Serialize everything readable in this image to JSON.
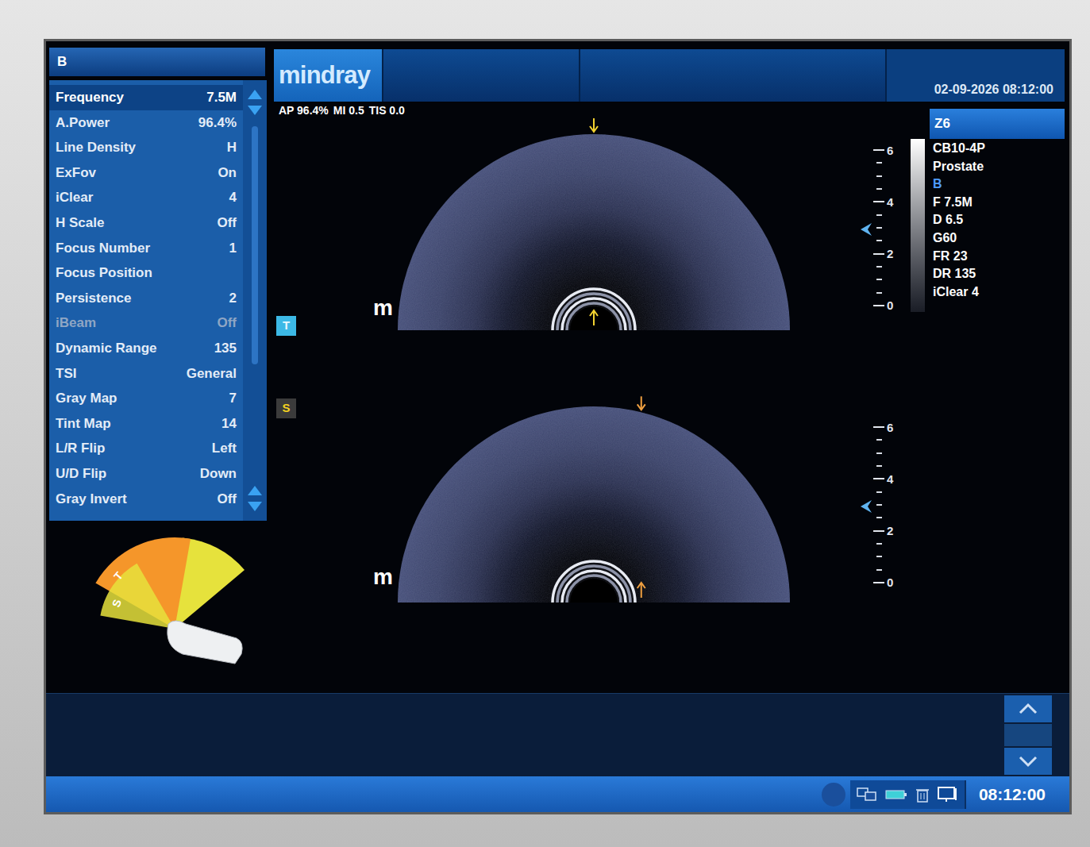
{
  "mode_panel": {
    "title": "B",
    "params": [
      {
        "label": "Frequency",
        "value": "7.5M",
        "selected": true,
        "disabled": false
      },
      {
        "label": "A.Power",
        "value": "96.4%",
        "selected": false,
        "disabled": false
      },
      {
        "label": "Line Density",
        "value": "H",
        "selected": false,
        "disabled": false
      },
      {
        "label": "ExFov",
        "value": "On",
        "selected": false,
        "disabled": false
      },
      {
        "label": "iClear",
        "value": "4",
        "selected": false,
        "disabled": false
      },
      {
        "label": "H Scale",
        "value": "Off",
        "selected": false,
        "disabled": false
      },
      {
        "label": "Focus Number",
        "value": "1",
        "selected": false,
        "disabled": false
      },
      {
        "label": "Focus Position",
        "selected": false,
        "disabled": false
      },
      {
        "label": "Persistence",
        "value": "2",
        "selected": false,
        "disabled": false
      },
      {
        "label": "iBeam",
        "value": "Off",
        "selected": false,
        "disabled": true
      },
      {
        "label": "Dynamic Range",
        "value": "135",
        "selected": false,
        "disabled": false
      },
      {
        "label": "TSI",
        "value": "General",
        "selected": false,
        "disabled": false
      },
      {
        "label": "Gray Map",
        "value": "7",
        "selected": false,
        "disabled": false
      },
      {
        "label": "Tint Map",
        "value": "14",
        "selected": false,
        "disabled": false
      },
      {
        "label": "L/R Flip",
        "value": "Left",
        "selected": false,
        "disabled": false
      },
      {
        "label": "U/D Flip",
        "value": "Down",
        "selected": false,
        "disabled": false
      },
      {
        "label": "Gray Invert",
        "value": "Off",
        "selected": false,
        "disabled": false
      }
    ]
  },
  "header": {
    "logo": "mindray",
    "datetime": "02-09-2026 08:12:00"
  },
  "acoustic": [
    "AP 96.4%",
    "MI 0.5",
    "TIS 0.0"
  ],
  "images": [
    {
      "label": "T",
      "selected": true,
      "logo": "m",
      "scale": [
        "6",
        "4",
        "2",
        "0"
      ],
      "focus": 0.49,
      "line_angle": 0
    },
    {
      "label": "S",
      "selected": false,
      "logo": "m",
      "scale": [
        "6",
        "4",
        "2",
        "0"
      ],
      "focus": 0.49,
      "line_angle": 14
    }
  ],
  "info": {
    "zoom": "Z6",
    "lines": [
      {
        "text": "CB10-4P",
        "color": "#ffffff"
      },
      {
        "text": "Prostate",
        "color": "#ffffff"
      },
      {
        "text": "B",
        "color": "#4f9bff"
      },
      {
        "text": "F 7.5M",
        "color": "#ffffff"
      },
      {
        "text": "D 6.5",
        "color": "#ffffff"
      },
      {
        "text": "G60",
        "color": "#ffffff"
      },
      {
        "text": "FR 23",
        "color": "#ffffff"
      },
      {
        "text": "DR 135",
        "color": "#ffffff"
      },
      {
        "text": "iClear 4",
        "color": "#ffffff"
      }
    ]
  },
  "probe_diagram": {
    "planes": [
      {
        "label": "T",
        "color": "#f5962a"
      },
      {
        "label": "S",
        "color": "#e6e23c"
      }
    ]
  },
  "status_bar": {
    "time": "08:12:00"
  }
}
